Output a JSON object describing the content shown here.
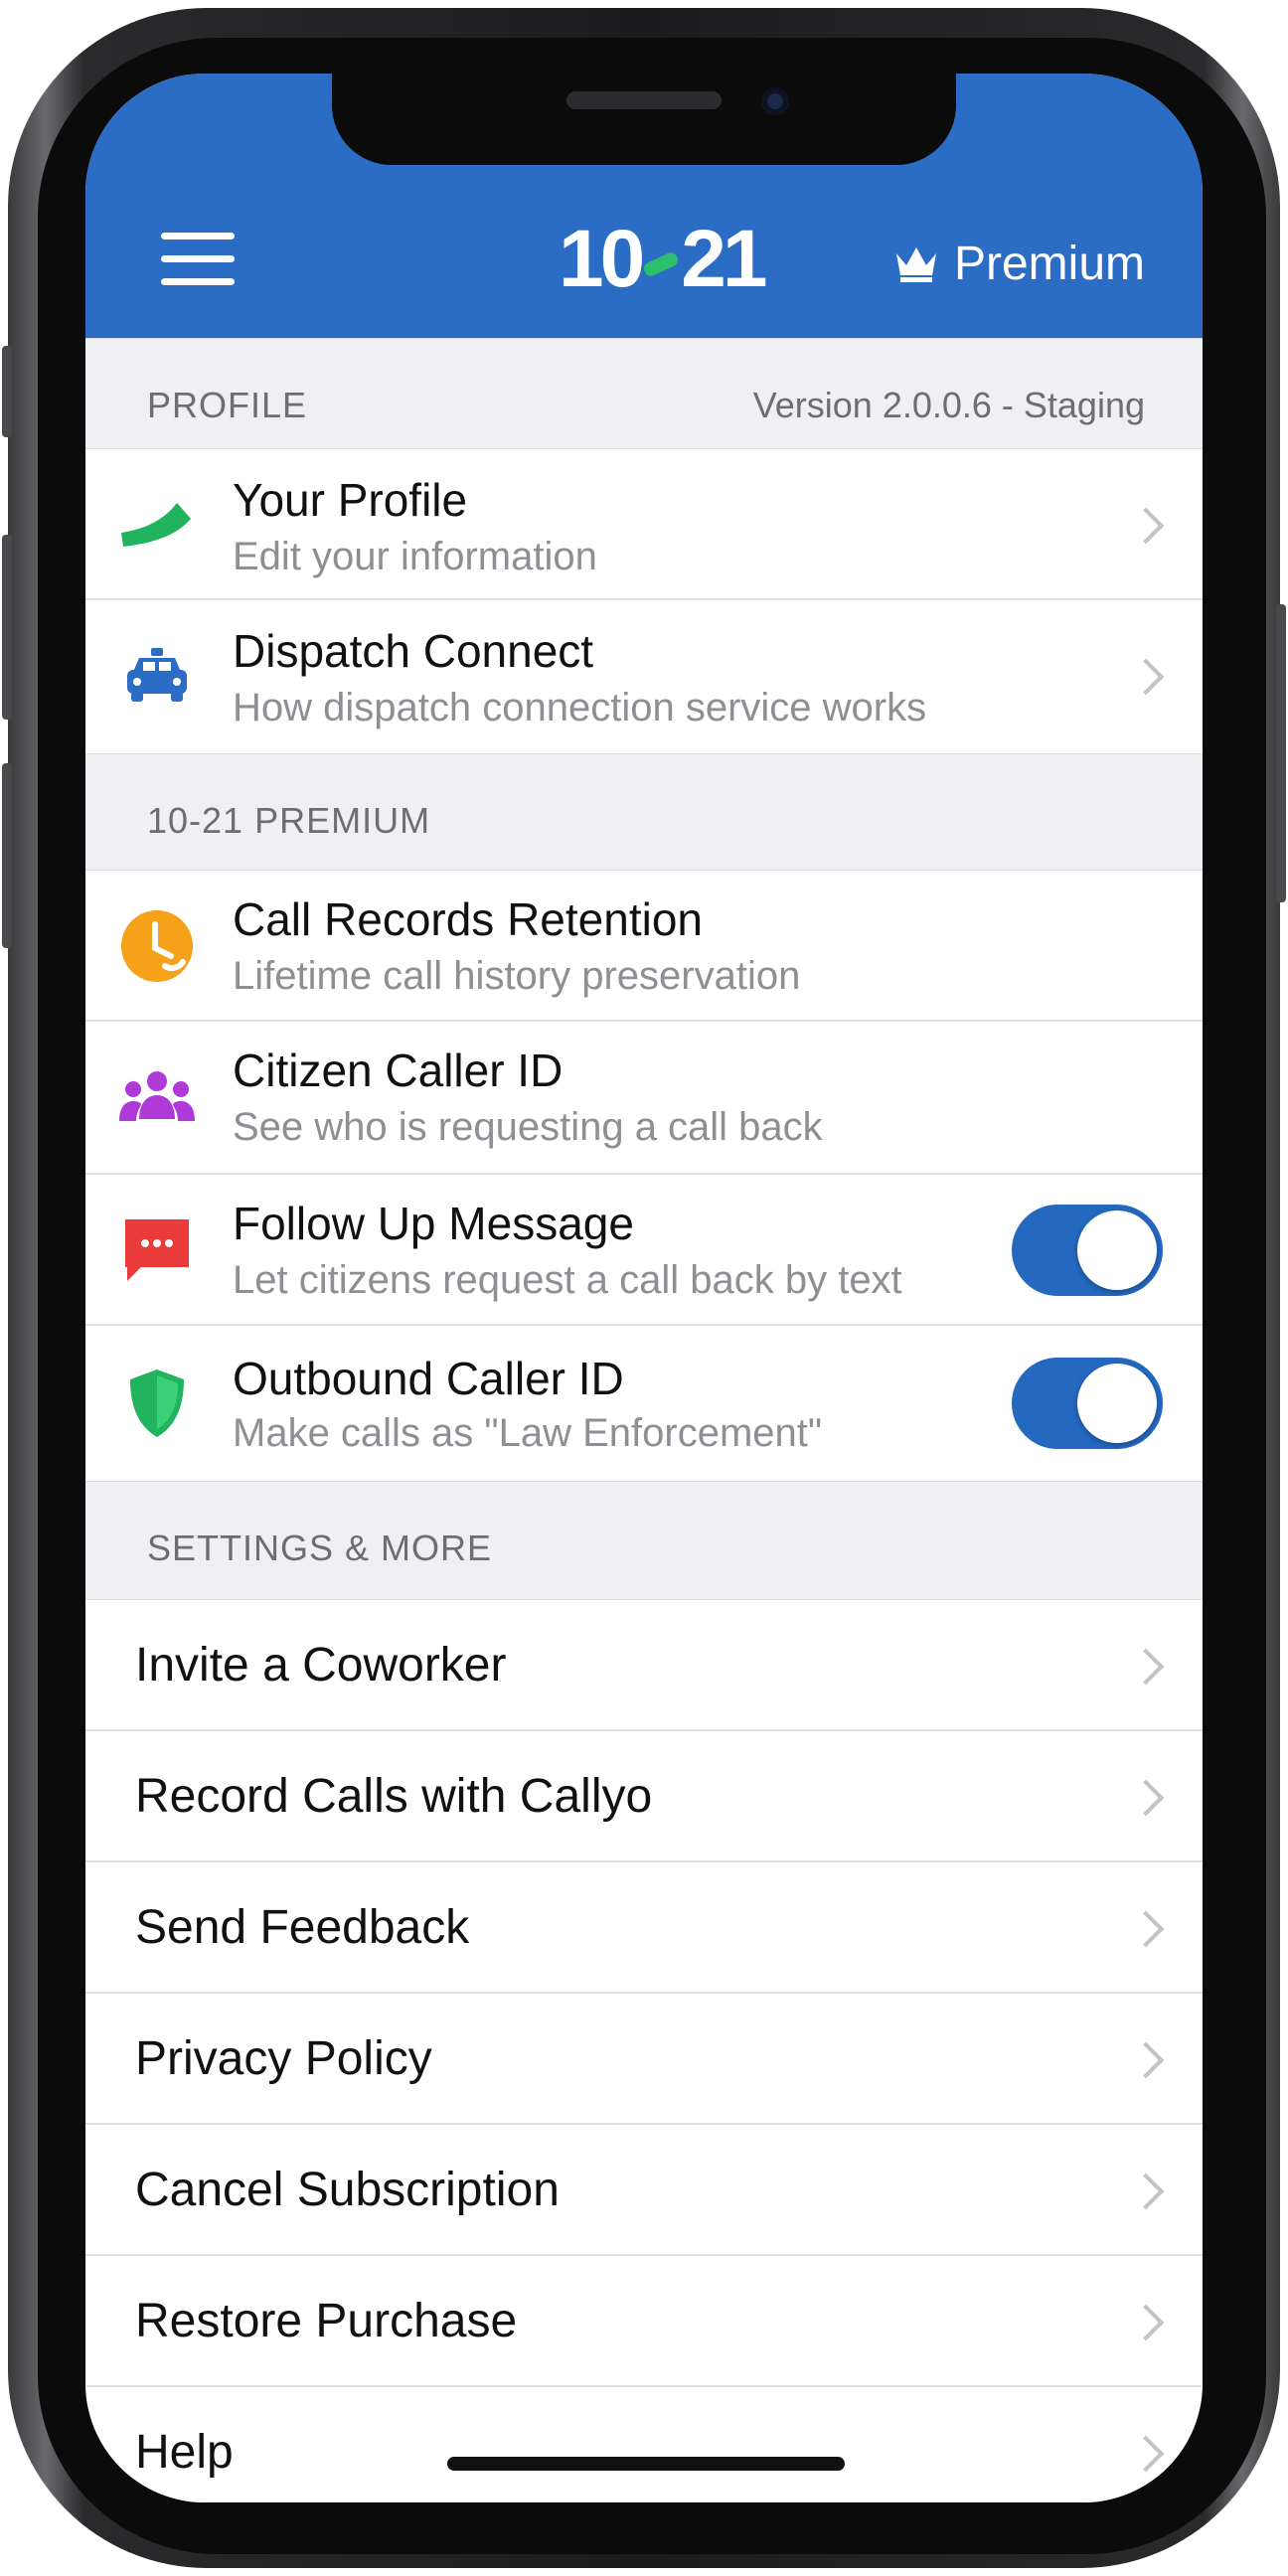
{
  "header": {
    "logo_text_left": "10",
    "logo_text_right": "21",
    "premium_label": "Premium",
    "background_color": "#2b6cc4"
  },
  "sections": {
    "profile": {
      "title": "PROFILE",
      "version": "Version 2.0.0.6 - Staging",
      "items": [
        {
          "title": "Your Profile",
          "subtitle": "Edit your information",
          "icon": "green-swoosh-icon"
        },
        {
          "title": "Dispatch Connect",
          "subtitle": "How dispatch connection service works",
          "icon": "police-car-icon"
        }
      ]
    },
    "premium": {
      "title": "10-21 PREMIUM",
      "items": [
        {
          "title": "Call Records Retention",
          "subtitle": "Lifetime call history preservation",
          "icon": "clock-phone-icon"
        },
        {
          "title": "Citizen Caller ID",
          "subtitle": "See who is requesting a call back",
          "icon": "people-group-icon"
        },
        {
          "title": "Follow Up Message",
          "subtitle": "Let citizens request a call back by text",
          "icon": "message-bubble-icon",
          "toggle_on": true
        },
        {
          "title": "Outbound Caller ID",
          "subtitle": "Make calls as \"Law Enforcement\"",
          "icon": "shield-icon",
          "toggle_on": true
        }
      ]
    },
    "settings": {
      "title": "SETTINGS & MORE",
      "items": [
        {
          "title": "Invite a Coworker"
        },
        {
          "title": "Record Calls with Callyo"
        },
        {
          "title": "Send Feedback"
        },
        {
          "title": "Privacy Policy"
        },
        {
          "title": "Cancel Subscription"
        },
        {
          "title": "Restore Purchase"
        },
        {
          "title": "Help"
        }
      ]
    }
  },
  "colors": {
    "accent": "#2b6cc4",
    "toggle": "#2468c0",
    "green": "#21b35e",
    "orange": "#f5a11a",
    "purple": "#b03ad8",
    "red": "#ea3b3b"
  }
}
